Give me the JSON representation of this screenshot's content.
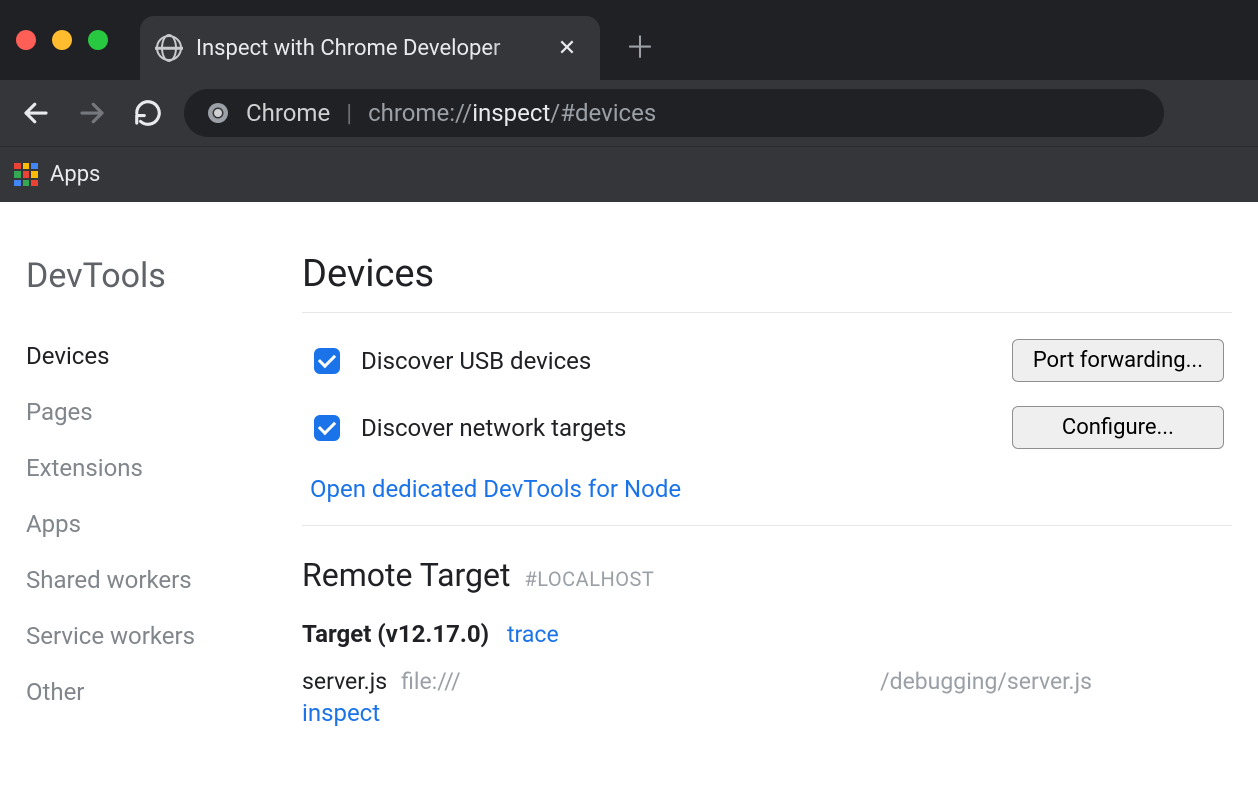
{
  "browser": {
    "tab_title": "Inspect with Chrome Developer",
    "omnibox": {
      "label": "Chrome",
      "scheme": "chrome://",
      "host": "inspect",
      "hash": "/#devices"
    },
    "bookmarks": {
      "apps_label": "Apps"
    }
  },
  "sidebar": {
    "title": "DevTools",
    "items": [
      {
        "label": "Devices",
        "active": true
      },
      {
        "label": "Pages"
      },
      {
        "label": "Extensions"
      },
      {
        "label": "Apps"
      },
      {
        "label": "Shared workers"
      },
      {
        "label": "Service workers"
      },
      {
        "label": "Other"
      }
    ]
  },
  "main": {
    "heading": "Devices",
    "usb": {
      "label": "Discover USB devices",
      "button": "Port forwarding..."
    },
    "net": {
      "label": "Discover network targets",
      "button": "Configure..."
    },
    "node_link": "Open dedicated DevTools for Node",
    "remote": {
      "heading": "Remote Target",
      "sub": "#LOCALHOST",
      "target_name": "Target (v12.17.0)",
      "trace": "trace",
      "file_name": "server.js",
      "file_scheme": "file:///",
      "file_suffix": "/debugging/server.js",
      "inspect": "inspect"
    }
  }
}
